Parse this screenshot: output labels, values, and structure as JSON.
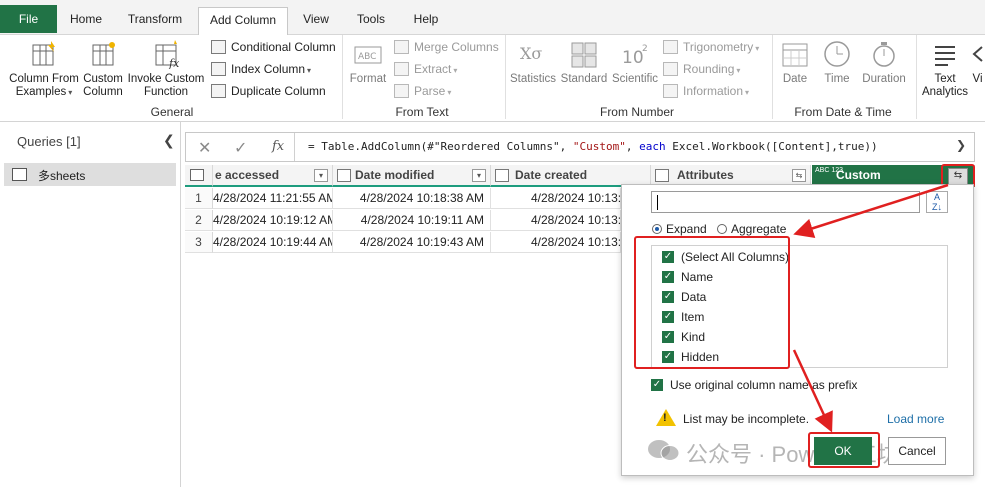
{
  "tabs": [
    {
      "label": "File",
      "active": false
    },
    {
      "label": "Home",
      "active": false
    },
    {
      "label": "Transform",
      "active": false
    },
    {
      "label": "Add Column",
      "active": true
    },
    {
      "label": "View",
      "active": false
    },
    {
      "label": "Tools",
      "active": false
    },
    {
      "label": "Help",
      "active": false
    }
  ],
  "ribbon": {
    "general": {
      "label": "General",
      "column_from_examples": "Column From",
      "column_from_examples_2": "Examples",
      "custom_column": "Custom",
      "custom_column_2": "Column",
      "invoke_custom": "Invoke Custom",
      "invoke_custom_2": "Function",
      "conditional_column": "Conditional Column",
      "index_column": "Index Column",
      "duplicate_column": "Duplicate Column"
    },
    "from_text": {
      "label": "From Text",
      "format": "Format",
      "merge_columns": "Merge Columns",
      "extract": "Extract",
      "parse": "Parse"
    },
    "from_number": {
      "label": "From Number",
      "statistics": "Statistics",
      "standard": "Standard",
      "scientific": "Scientific",
      "trigonometry": "Trigonometry",
      "rounding": "Rounding",
      "information": "Information"
    },
    "from_date_time": {
      "label": "From Date & Time",
      "date": "Date",
      "time": "Time",
      "duration": "Duration"
    },
    "ai": {
      "text_analytics": "Text",
      "text_analytics_2": "Analytics",
      "vision": "Vi"
    }
  },
  "queries": {
    "title": "Queries [1]",
    "items": [
      {
        "label": "多sheets"
      }
    ]
  },
  "formula": {
    "prefix": "= Table.AddColumn(#\"Reordered Columns\", ",
    "string": "\"Custom\"",
    "mid": ", ",
    "keyword": "each",
    "suffix": " Excel.Workbook([Content],true))"
  },
  "grid": {
    "headers": [
      "e accessed",
      "Date modified",
      "Date created",
      "Attributes",
      "Custom"
    ],
    "custom_type": "ABC 123",
    "rows": [
      {
        "num": "1",
        "accessed": "4/28/2024 11:21:55 AM",
        "modified": "4/28/2024 10:18:38 AM",
        "created": "4/28/2024 10:13:2"
      },
      {
        "num": "2",
        "accessed": "4/28/2024 10:19:12 AM",
        "modified": "4/28/2024 10:19:11 AM",
        "created": "4/28/2024 10:13:2"
      },
      {
        "num": "3",
        "accessed": "4/28/2024 10:19:44 AM",
        "modified": "4/28/2024 10:19:43 AM",
        "created": "4/28/2024 10:13:2"
      }
    ]
  },
  "popup": {
    "search_value": "",
    "expand_label": "Expand",
    "aggregate_label": "Aggregate",
    "columns": [
      {
        "label": "(Select All Columns)",
        "checked": true
      },
      {
        "label": "Name",
        "checked": true
      },
      {
        "label": "Data",
        "checked": true
      },
      {
        "label": "Item",
        "checked": true
      },
      {
        "label": "Kind",
        "checked": true
      },
      {
        "label": "Hidden",
        "checked": true
      }
    ],
    "prefix_label": "Use original column name as prefix",
    "warning": "List may be incomplete.",
    "load_more": "Load more",
    "ok": "OK",
    "cancel": "Cancel"
  },
  "watermark": "公众号 · PowerBI工坊",
  "colors": {
    "accent": "#217346",
    "highlight": "#e02020",
    "header_underline": "#1e9c7e"
  }
}
